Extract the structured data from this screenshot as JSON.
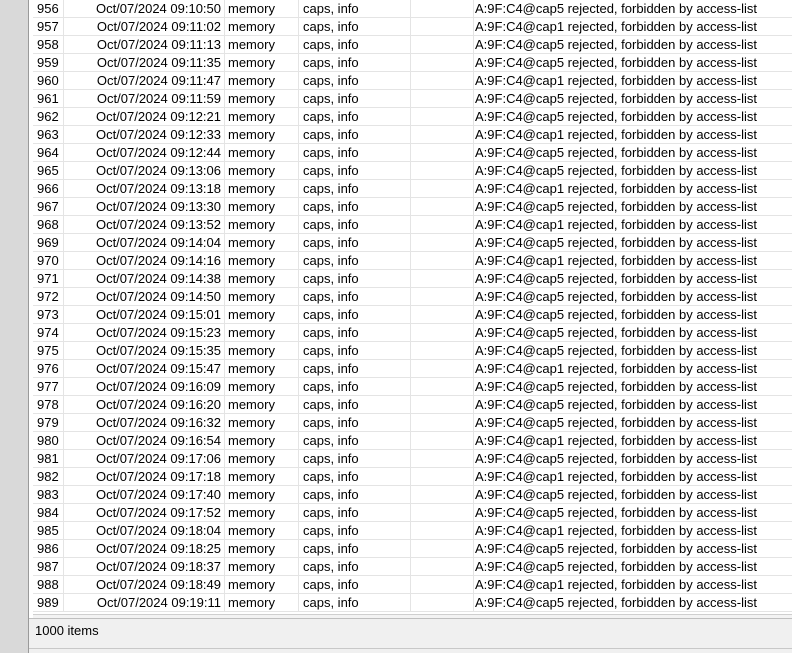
{
  "log": {
    "rows": [
      {
        "num": "956",
        "time": "Oct/07/2024 09:10:50",
        "buffer": "memory",
        "topics": "caps, info",
        "message": "A:9F:C4@cap5 rejected, forbidden by access-list"
      },
      {
        "num": "957",
        "time": "Oct/07/2024 09:11:02",
        "buffer": "memory",
        "topics": "caps, info",
        "message": "A:9F:C4@cap1 rejected, forbidden by access-list"
      },
      {
        "num": "958",
        "time": "Oct/07/2024 09:11:13",
        "buffer": "memory",
        "topics": "caps, info",
        "message": "A:9F:C4@cap5 rejected, forbidden by access-list"
      },
      {
        "num": "959",
        "time": "Oct/07/2024 09:11:35",
        "buffer": "memory",
        "topics": "caps, info",
        "message": "A:9F:C4@cap5 rejected, forbidden by access-list"
      },
      {
        "num": "960",
        "time": "Oct/07/2024 09:11:47",
        "buffer": "memory",
        "topics": "caps, info",
        "message": "A:9F:C4@cap1 rejected, forbidden by access-list"
      },
      {
        "num": "961",
        "time": "Oct/07/2024 09:11:59",
        "buffer": "memory",
        "topics": "caps, info",
        "message": "A:9F:C4@cap5 rejected, forbidden by access-list"
      },
      {
        "num": "962",
        "time": "Oct/07/2024 09:12:21",
        "buffer": "memory",
        "topics": "caps, info",
        "message": "A:9F:C4@cap5 rejected, forbidden by access-list"
      },
      {
        "num": "963",
        "time": "Oct/07/2024 09:12:33",
        "buffer": "memory",
        "topics": "caps, info",
        "message": "A:9F:C4@cap1 rejected, forbidden by access-list"
      },
      {
        "num": "964",
        "time": "Oct/07/2024 09:12:44",
        "buffer": "memory",
        "topics": "caps, info",
        "message": "A:9F:C4@cap5 rejected, forbidden by access-list"
      },
      {
        "num": "965",
        "time": "Oct/07/2024 09:13:06",
        "buffer": "memory",
        "topics": "caps, info",
        "message": "A:9F:C4@cap5 rejected, forbidden by access-list"
      },
      {
        "num": "966",
        "time": "Oct/07/2024 09:13:18",
        "buffer": "memory",
        "topics": "caps, info",
        "message": "A:9F:C4@cap1 rejected, forbidden by access-list"
      },
      {
        "num": "967",
        "time": "Oct/07/2024 09:13:30",
        "buffer": "memory",
        "topics": "caps, info",
        "message": "A:9F:C4@cap5 rejected, forbidden by access-list"
      },
      {
        "num": "968",
        "time": "Oct/07/2024 09:13:52",
        "buffer": "memory",
        "topics": "caps, info",
        "message": "A:9F:C4@cap1 rejected, forbidden by access-list"
      },
      {
        "num": "969",
        "time": "Oct/07/2024 09:14:04",
        "buffer": "memory",
        "topics": "caps, info",
        "message": "A:9F:C4@cap5 rejected, forbidden by access-list"
      },
      {
        "num": "970",
        "time": "Oct/07/2024 09:14:16",
        "buffer": "memory",
        "topics": "caps, info",
        "message": "A:9F:C4@cap1 rejected, forbidden by access-list"
      },
      {
        "num": "971",
        "time": "Oct/07/2024 09:14:38",
        "buffer": "memory",
        "topics": "caps, info",
        "message": "A:9F:C4@cap5 rejected, forbidden by access-list"
      },
      {
        "num": "972",
        "time": "Oct/07/2024 09:14:50",
        "buffer": "memory",
        "topics": "caps, info",
        "message": "A:9F:C4@cap5 rejected, forbidden by access-list"
      },
      {
        "num": "973",
        "time": "Oct/07/2024 09:15:01",
        "buffer": "memory",
        "topics": "caps, info",
        "message": "A:9F:C4@cap5 rejected, forbidden by access-list"
      },
      {
        "num": "974",
        "time": "Oct/07/2024 09:15:23",
        "buffer": "memory",
        "topics": "caps, info",
        "message": "A:9F:C4@cap5 rejected, forbidden by access-list"
      },
      {
        "num": "975",
        "time": "Oct/07/2024 09:15:35",
        "buffer": "memory",
        "topics": "caps, info",
        "message": "A:9F:C4@cap5 rejected, forbidden by access-list"
      },
      {
        "num": "976",
        "time": "Oct/07/2024 09:15:47",
        "buffer": "memory",
        "topics": "caps, info",
        "message": "A:9F:C4@cap1 rejected, forbidden by access-list"
      },
      {
        "num": "977",
        "time": "Oct/07/2024 09:16:09",
        "buffer": "memory",
        "topics": "caps, info",
        "message": "A:9F:C4@cap5 rejected, forbidden by access-list"
      },
      {
        "num": "978",
        "time": "Oct/07/2024 09:16:20",
        "buffer": "memory",
        "topics": "caps, info",
        "message": "A:9F:C4@cap5 rejected, forbidden by access-list"
      },
      {
        "num": "979",
        "time": "Oct/07/2024 09:16:32",
        "buffer": "memory",
        "topics": "caps, info",
        "message": "A:9F:C4@cap5 rejected, forbidden by access-list"
      },
      {
        "num": "980",
        "time": "Oct/07/2024 09:16:54",
        "buffer": "memory",
        "topics": "caps, info",
        "message": "A:9F:C4@cap1 rejected, forbidden by access-list"
      },
      {
        "num": "981",
        "time": "Oct/07/2024 09:17:06",
        "buffer": "memory",
        "topics": "caps, info",
        "message": "A:9F:C4@cap5 rejected, forbidden by access-list"
      },
      {
        "num": "982",
        "time": "Oct/07/2024 09:17:18",
        "buffer": "memory",
        "topics": "caps, info",
        "message": "A:9F:C4@cap1 rejected, forbidden by access-list"
      },
      {
        "num": "983",
        "time": "Oct/07/2024 09:17:40",
        "buffer": "memory",
        "topics": "caps, info",
        "message": "A:9F:C4@cap5 rejected, forbidden by access-list"
      },
      {
        "num": "984",
        "time": "Oct/07/2024 09:17:52",
        "buffer": "memory",
        "topics": "caps, info",
        "message": "A:9F:C4@cap5 rejected, forbidden by access-list"
      },
      {
        "num": "985",
        "time": "Oct/07/2024 09:18:04",
        "buffer": "memory",
        "topics": "caps, info",
        "message": "A:9F:C4@cap1 rejected, forbidden by access-list"
      },
      {
        "num": "986",
        "time": "Oct/07/2024 09:18:25",
        "buffer": "memory",
        "topics": "caps, info",
        "message": "A:9F:C4@cap5 rejected, forbidden by access-list"
      },
      {
        "num": "987",
        "time": "Oct/07/2024 09:18:37",
        "buffer": "memory",
        "topics": "caps, info",
        "message": "A:9F:C4@cap5 rejected, forbidden by access-list"
      },
      {
        "num": "988",
        "time": "Oct/07/2024 09:18:49",
        "buffer": "memory",
        "topics": "caps, info",
        "message": "A:9F:C4@cap1 rejected, forbidden by access-list"
      },
      {
        "num": "989",
        "time": "Oct/07/2024 09:19:11",
        "buffer": "memory",
        "topics": "caps, info",
        "message": "A:9F:C4@cap5 rejected, forbidden by access-list"
      }
    ]
  },
  "status": {
    "item_count": "1000 items"
  }
}
